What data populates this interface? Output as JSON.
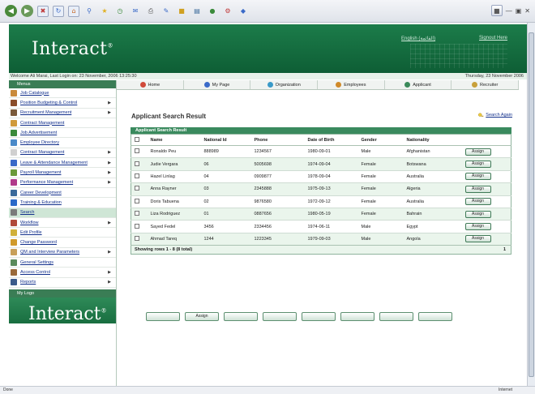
{
  "welcome": {
    "text": "Welcome Ali Marai, Last Login on: 23 November, 2006 13:25:30",
    "date": "Thursday, 23 November 2006"
  },
  "header": {
    "logo": "Interact",
    "logo_mark": "®",
    "link_english": "English (القائمة)",
    "link_logout": "Signout Here"
  },
  "sidebar": {
    "menus_label": "Menus",
    "items": [
      {
        "label": "Job Catalogue",
        "arrow": false,
        "icon_color": "#c98a3b"
      },
      {
        "label": "Position Budgeting & Control",
        "arrow": true,
        "icon_color": "#8a4d2a"
      },
      {
        "label": "Recruitment Management",
        "arrow": true,
        "icon_color": "#7a5a3a"
      },
      {
        "label": "Contract Management",
        "arrow": false,
        "icon_color": "#d09a3a"
      },
      {
        "label": "Job Advertisement",
        "arrow": false,
        "icon_color": "#3a8a3a"
      },
      {
        "label": "Employee Directory",
        "arrow": false,
        "icon_color": "#4a8ac8"
      },
      {
        "label": "Contract Management",
        "arrow": true,
        "icon_color": "#d0d0d0"
      },
      {
        "label": "Leave & Attendance Management",
        "arrow": true,
        "icon_color": "#3a6ac8"
      },
      {
        "label": "Payroll Management",
        "arrow": true,
        "icon_color": "#6a9a3a"
      },
      {
        "label": "Performance Management",
        "arrow": true,
        "icon_color": "#b03a8a"
      },
      {
        "label": "Career Development",
        "arrow": false,
        "icon_color": "#3a6a9a"
      },
      {
        "label": "Training & Education",
        "arrow": false,
        "icon_color": "#2a6ac8"
      },
      {
        "label": "Search",
        "arrow": false,
        "icon_color": "#7a7a7a",
        "active": true
      },
      {
        "label": "Workflow",
        "arrow": true,
        "icon_color": "#b04a3a"
      },
      {
        "label": "Edit Profile",
        "arrow": false,
        "icon_color": "#d0b03a"
      },
      {
        "label": "Change Password",
        "arrow": false,
        "icon_color": "#d09a2a"
      },
      {
        "label": "QM and Interview Parameters",
        "arrow": true,
        "icon_color": "#c8a05a"
      },
      {
        "label": "General Settings",
        "arrow": false,
        "icon_color": "#5a8a5a"
      },
      {
        "label": "Access Control",
        "arrow": true,
        "icon_color": "#9a6a3a"
      },
      {
        "label": "Reports",
        "arrow": true,
        "icon_color": "#3a5a8a"
      }
    ],
    "my_logo_label": "My Logo",
    "my_logo_text": "Interact",
    "my_logo_mark": "®"
  },
  "topnav": {
    "tabs": [
      {
        "label": "Home",
        "icon_color": "#d04a3a"
      },
      {
        "label": "My Page",
        "icon_color": "#3a6ac8"
      },
      {
        "label": "Organization",
        "icon_color": "#3a9ac8"
      },
      {
        "label": "Employees",
        "icon_color": "#d08a2a"
      },
      {
        "label": "Applicant",
        "icon_color": "#3a8a5a"
      },
      {
        "label": "Recruiter",
        "icon_color": "#c8a03a"
      }
    ]
  },
  "main": {
    "title": "Applicant Search Result",
    "search_again": "Search Again",
    "table_caption": "Applicant Search Result",
    "columns": [
      "Name",
      "National Id",
      "Phone",
      "Date of Birth",
      "Gender",
      "Nationality"
    ],
    "rows": [
      {
        "name": "Ronaldo Peu",
        "national_id": "888989",
        "phone": "1234567",
        "dob": "1980-09-01",
        "gender": "Male",
        "nationality": "Afghanistan"
      },
      {
        "name": "Judie Vergara",
        "national_id": "06",
        "phone": "5005698",
        "dob": "1974-09-04",
        "gender": "Female",
        "nationality": "Botswana"
      },
      {
        "name": "Hazel Linlag",
        "national_id": "04",
        "phone": "0909877",
        "dob": "1978-09-04",
        "gender": "Female",
        "nationality": "Australia"
      },
      {
        "name": "Anna Rayner",
        "national_id": "03",
        "phone": "2345888",
        "dob": "1975-09-13",
        "gender": "Female",
        "nationality": "Algeria"
      },
      {
        "name": "Doris Tabuena",
        "national_id": "02",
        "phone": "9876580",
        "dob": "1972-09-12",
        "gender": "Female",
        "nationality": "Australia"
      },
      {
        "name": "Liza Rodriguez",
        "national_id": "01",
        "phone": "0887656",
        "dob": "1980-05-19",
        "gender": "Female",
        "nationality": "Bahrain"
      },
      {
        "name": "Sayed Fedel",
        "national_id": "3456",
        "phone": "2334456",
        "dob": "1974-06-11",
        "gender": "Male",
        "nationality": "Egypt"
      },
      {
        "name": "Ahmad Tareq",
        "national_id": "1244",
        "phone": "1223345",
        "dob": "1979-09-03",
        "gender": "Male",
        "nationality": "Angola"
      }
    ],
    "assign_label": "Assign",
    "footer_text": "Showing rows 1 - 8   (8 total)",
    "footer_page": "1",
    "action_buttons": [
      "",
      "Assign",
      "",
      "",
      "",
      "",
      "",
      ""
    ]
  },
  "statusbar": {
    "left": "Done",
    "right": "Internet"
  }
}
